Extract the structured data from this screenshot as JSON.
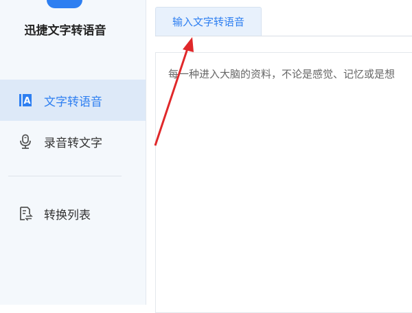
{
  "app": {
    "name": "迅捷文字转语音",
    "logo_icon": "app-logo-icon",
    "accent_color": "#2e7ff1"
  },
  "sidebar": {
    "items": [
      {
        "label": "文字转语音",
        "icon": "text-a-icon",
        "active": true
      },
      {
        "label": "录音转文字",
        "icon": "microphone-icon",
        "active": false
      },
      {
        "label": "转换列表",
        "icon": "convert-list-icon",
        "active": false
      }
    ]
  },
  "main": {
    "tab_label": "输入文字转语音",
    "editor_text": "每一种进入大脑的资料，不论是感觉、记忆或是想"
  },
  "annotation": {
    "arrow_color": "#e0282a"
  }
}
